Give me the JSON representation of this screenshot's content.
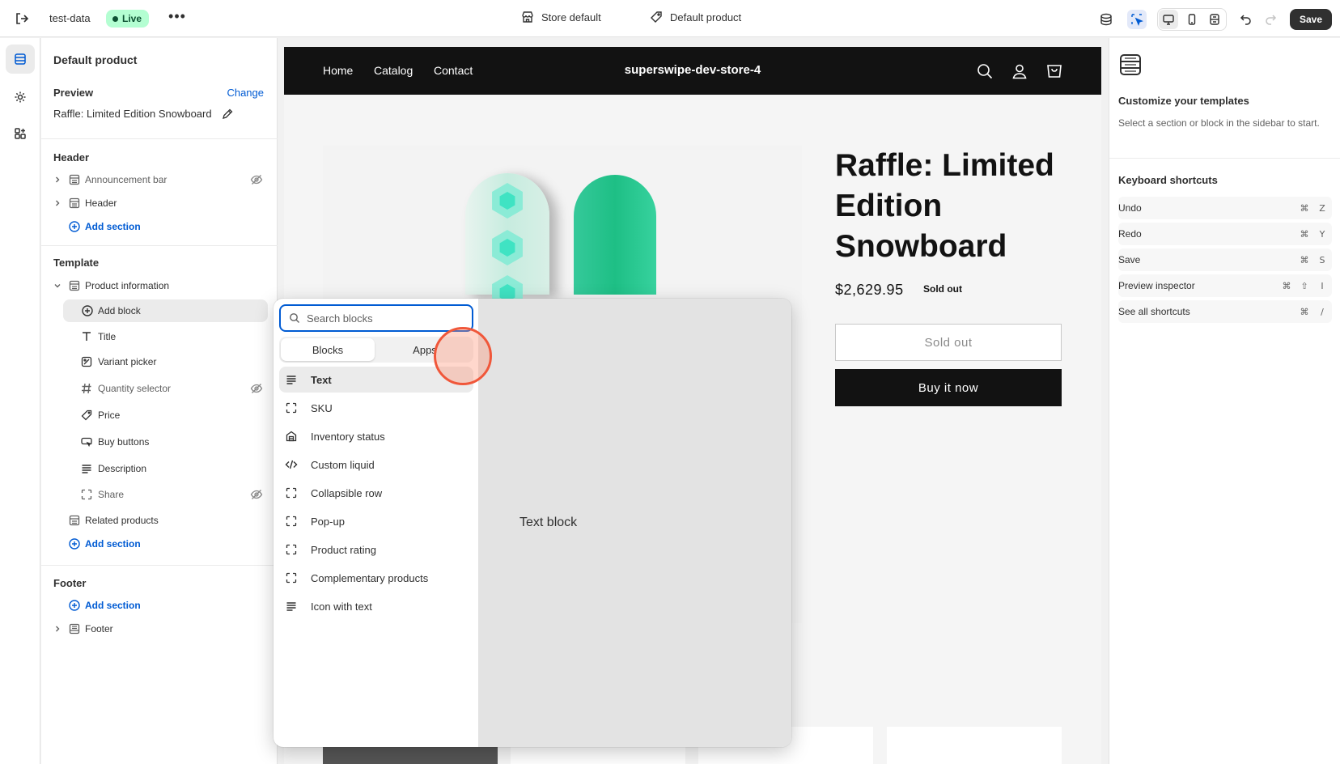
{
  "topbar": {
    "store_name": "test-data",
    "status": "Live",
    "more": "•••",
    "theme_selector": "Store default",
    "template_selector": "Default product",
    "save_label": "Save"
  },
  "sidebar": {
    "title": "Default product",
    "preview_label": "Preview",
    "change_label": "Change",
    "preview_value": "Raffle: Limited Edition Snowboard",
    "header_group": "Header",
    "header_items": [
      {
        "label": "Announcement bar",
        "hidden": true
      },
      {
        "label": "Header",
        "hidden": false
      }
    ],
    "add_section": "Add section",
    "template_group": "Template",
    "product_information": "Product information",
    "add_block": "Add block",
    "blocks": [
      {
        "label": "Title",
        "icon": "title-icon",
        "hidden": false
      },
      {
        "label": "Variant picker",
        "icon": "variant-picker-icon",
        "hidden": false
      },
      {
        "label": "Quantity selector",
        "icon": "hashtag-icon",
        "hidden": true
      },
      {
        "label": "Price",
        "icon": "price-tag-icon",
        "hidden": false
      },
      {
        "label": "Buy buttons",
        "icon": "buy-buttons-icon",
        "hidden": false
      },
      {
        "label": "Description",
        "icon": "text-lines-icon",
        "hidden": false
      },
      {
        "label": "Share",
        "icon": "share-frame-icon",
        "hidden": true
      }
    ],
    "related_products": "Related products",
    "footer_group": "Footer",
    "footer_item": "Footer"
  },
  "store": {
    "nav_links": [
      "Home",
      "Catalog",
      "Contact"
    ],
    "brand": "superswipe-dev-store-4",
    "product_title": "Raffle: Limited Edition Snowboard",
    "price": "$2,629.95",
    "badge": "Sold out",
    "sold_out_button": "Sold out",
    "buy_now_button": "Buy it now"
  },
  "popover": {
    "search_placeholder": "Search blocks",
    "tabs": [
      "Blocks",
      "Apps"
    ],
    "items": [
      {
        "label": "Text",
        "icon": "text-lines-icon",
        "selected": true
      },
      {
        "label": "SKU",
        "icon": "frame-icon"
      },
      {
        "label": "Inventory status",
        "icon": "inventory-icon"
      },
      {
        "label": "Custom liquid",
        "icon": "code-icon"
      },
      {
        "label": "Collapsible row",
        "icon": "frame-icon"
      },
      {
        "label": "Pop-up",
        "icon": "frame-icon"
      },
      {
        "label": "Product rating",
        "icon": "frame-icon"
      },
      {
        "label": "Complementary products",
        "icon": "frame-icon"
      },
      {
        "label": "Icon with text",
        "icon": "text-lines-icon"
      }
    ],
    "preview_text": "Text block"
  },
  "right_panel": {
    "title": "Customize your templates",
    "description": "Select a section or block in the sidebar to start.",
    "shortcuts_title": "Keyboard shortcuts",
    "shortcuts": [
      {
        "label": "Undo",
        "keys": [
          "⌘",
          "Z"
        ]
      },
      {
        "label": "Redo",
        "keys": [
          "⌘",
          "Y"
        ]
      },
      {
        "label": "Save",
        "keys": [
          "⌘",
          "S"
        ]
      },
      {
        "label": "Preview inspector",
        "keys": [
          "⌘",
          "⇧",
          "I"
        ]
      },
      {
        "label": "See all shortcuts",
        "keys": [
          "⌘",
          "/"
        ]
      }
    ]
  },
  "colors": {
    "accent": "#005bd3",
    "live_badge": "#b4fed2",
    "store_nav": "#121212",
    "click_indicator": "#f0573a"
  }
}
